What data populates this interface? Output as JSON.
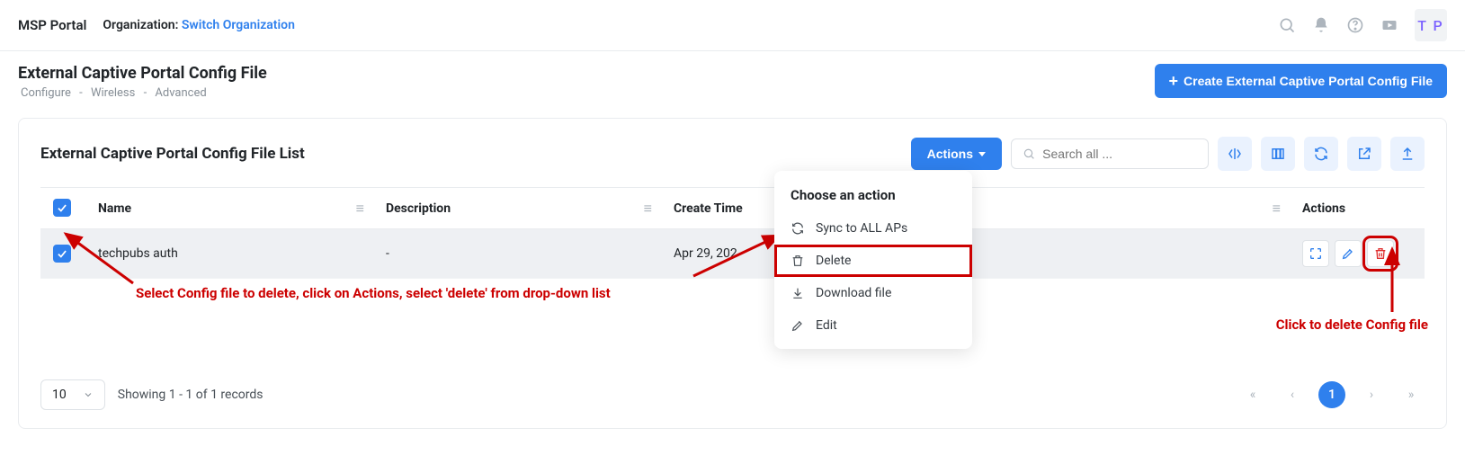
{
  "topbar": {
    "portal": "MSP Portal",
    "org_label": "Organization:",
    "switch_org": "Switch Organization",
    "avatar": "T P"
  },
  "header": {
    "title": "External Captive Portal Config File",
    "breadcrumb": [
      "Configure",
      "Wireless",
      "Advanced"
    ],
    "create_btn": "Create External Captive Portal Config File"
  },
  "list": {
    "title": "External Captive Portal Config File List",
    "actions_btn": "Actions",
    "search_placeholder": "Search all ..."
  },
  "dropdown": {
    "title": "Choose an action",
    "items": [
      {
        "icon": "sync",
        "label": "Sync to ALL APs"
      },
      {
        "icon": "trash",
        "label": "Delete"
      },
      {
        "icon": "download",
        "label": "Download file"
      },
      {
        "icon": "pencil",
        "label": "Edit"
      }
    ]
  },
  "table": {
    "columns": [
      "",
      "Name",
      "Description",
      "Create Time",
      "",
      "Actions"
    ],
    "rows": [
      {
        "checked": true,
        "name": "techpubs auth",
        "description": "-",
        "create_time": "Apr 29, 202"
      }
    ]
  },
  "annotations": {
    "left": "Select Config file to delete, click on Actions, select 'delete' from drop-down list",
    "right": "Click to delete Config file"
  },
  "footer": {
    "page_size": "10",
    "records": "Showing 1 - 1 of 1 records",
    "current_page": "1"
  }
}
